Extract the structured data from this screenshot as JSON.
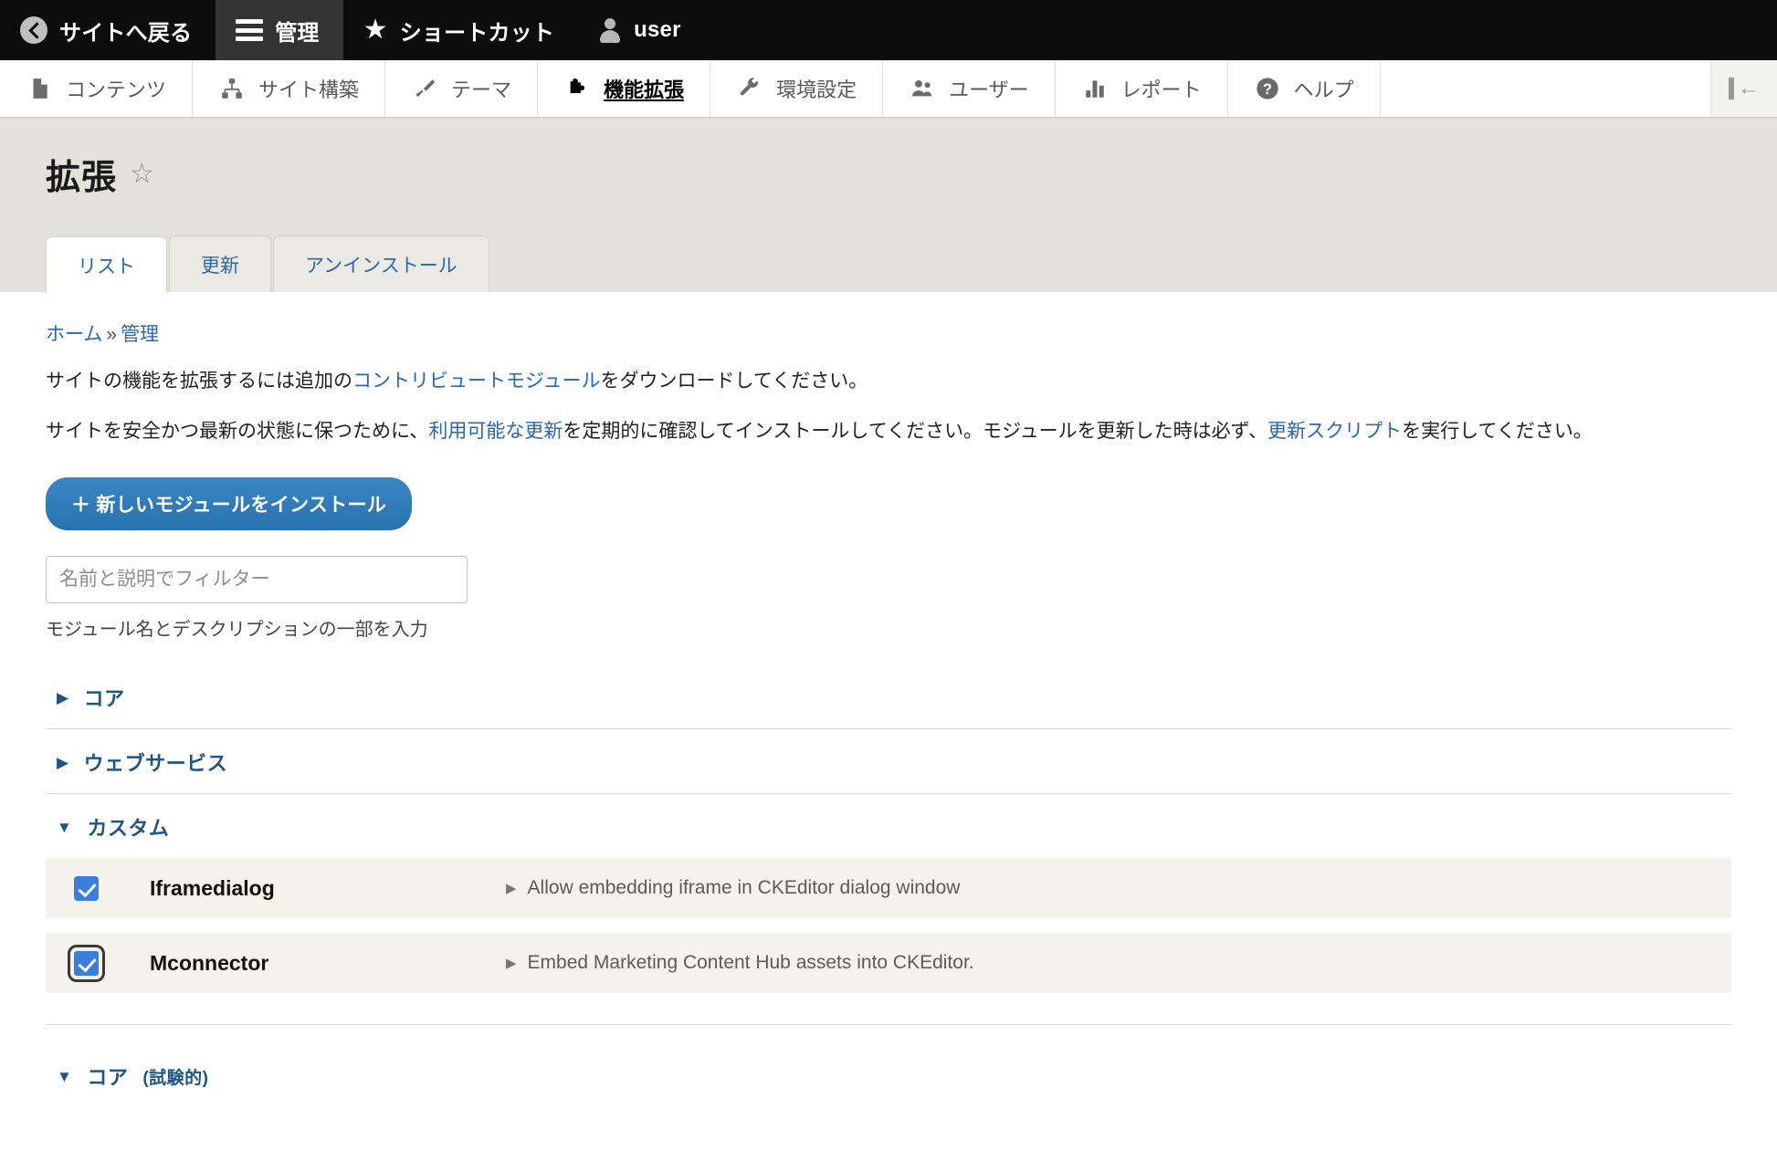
{
  "toolbar": {
    "items": [
      {
        "label": "サイトへ戻る",
        "icon": "back-arrow-icon",
        "active": false
      },
      {
        "label": "管理",
        "icon": "hamburger-icon",
        "active": true
      },
      {
        "label": "ショートカット",
        "icon": "star-icon",
        "active": false
      },
      {
        "label": "user",
        "icon": "user-icon",
        "active": false
      }
    ]
  },
  "admin_menu": {
    "items": [
      {
        "label": "コンテンツ",
        "icon": "document-icon",
        "active": false
      },
      {
        "label": "サイト構築",
        "icon": "sitemap-icon",
        "active": false
      },
      {
        "label": "テーマ",
        "icon": "paintbrush-icon",
        "active": false
      },
      {
        "label": "機能拡張",
        "icon": "puzzle-icon",
        "active": true
      },
      {
        "label": "環境設定",
        "icon": "wrench-icon",
        "active": false
      },
      {
        "label": "ユーザー",
        "icon": "people-icon",
        "active": false
      },
      {
        "label": "レポート",
        "icon": "bar-chart-icon",
        "active": false
      },
      {
        "label": "ヘルプ",
        "icon": "question-circle-icon",
        "active": false
      }
    ],
    "collapse_icon": "collapse-toolbar-icon"
  },
  "page": {
    "title": "拡張",
    "favorite_icon": "star-outline-icon",
    "tabs": [
      {
        "label": "リスト",
        "active": true
      },
      {
        "label": "更新",
        "active": false
      },
      {
        "label": "アンインストール",
        "active": false
      }
    ],
    "breadcrumb": {
      "home": "ホーム",
      "separator": "»",
      "current": "管理"
    },
    "intro_1": {
      "before": "サイトの機能を拡張するには追加の",
      "link": "コントリビュートモジュール",
      "after": "をダウンロードしてください。"
    },
    "intro_2": {
      "before": "サイトを安全かつ最新の状態に保つために、",
      "link1": "利用可能な更新",
      "middle": "を定期的に確認してインストールしてください。モジュールを更新した時は必ず、",
      "link2": "更新スクリプト",
      "after": "を実行してください。"
    },
    "install_button": "＋ 新しいモジュールをインストール",
    "filter": {
      "placeholder": "名前と説明でフィルター",
      "value": "",
      "description": "モジュール名とデスクリプションの一部を入力"
    }
  },
  "packages": [
    {
      "name": "コア",
      "suffix": "",
      "expanded": false,
      "arrow": "▶",
      "modules": []
    },
    {
      "name": "ウェブサービス",
      "suffix": "",
      "expanded": false,
      "arrow": "▶",
      "modules": []
    },
    {
      "name": "カスタム",
      "suffix": "",
      "expanded": true,
      "arrow": "▼",
      "modules": [
        {
          "name": "Iframedialog",
          "description": "Allow embedding iframe in CKEditor dialog window",
          "checked": true,
          "focused": false,
          "desc_arrow": "▶"
        },
        {
          "name": "Mconnector",
          "description": "Embed Marketing Content Hub assets into CKEditor.",
          "checked": true,
          "focused": true,
          "desc_arrow": "▶"
        }
      ]
    },
    {
      "name": "コア",
      "suffix": "(試験的)",
      "expanded": true,
      "arrow": "▼",
      "modules": []
    }
  ],
  "colors": {
    "toolbar_bg": "#0d0d0d",
    "toolbar_active_bg": "#333333",
    "page_header_bg": "#e2e2da",
    "link_blue": "#2868b0",
    "package_heading": "#1f5584",
    "button_blue": "#2b7bbc",
    "checkbox_blue": "#3b7ddd",
    "row_bg": "#f3f3ec"
  }
}
